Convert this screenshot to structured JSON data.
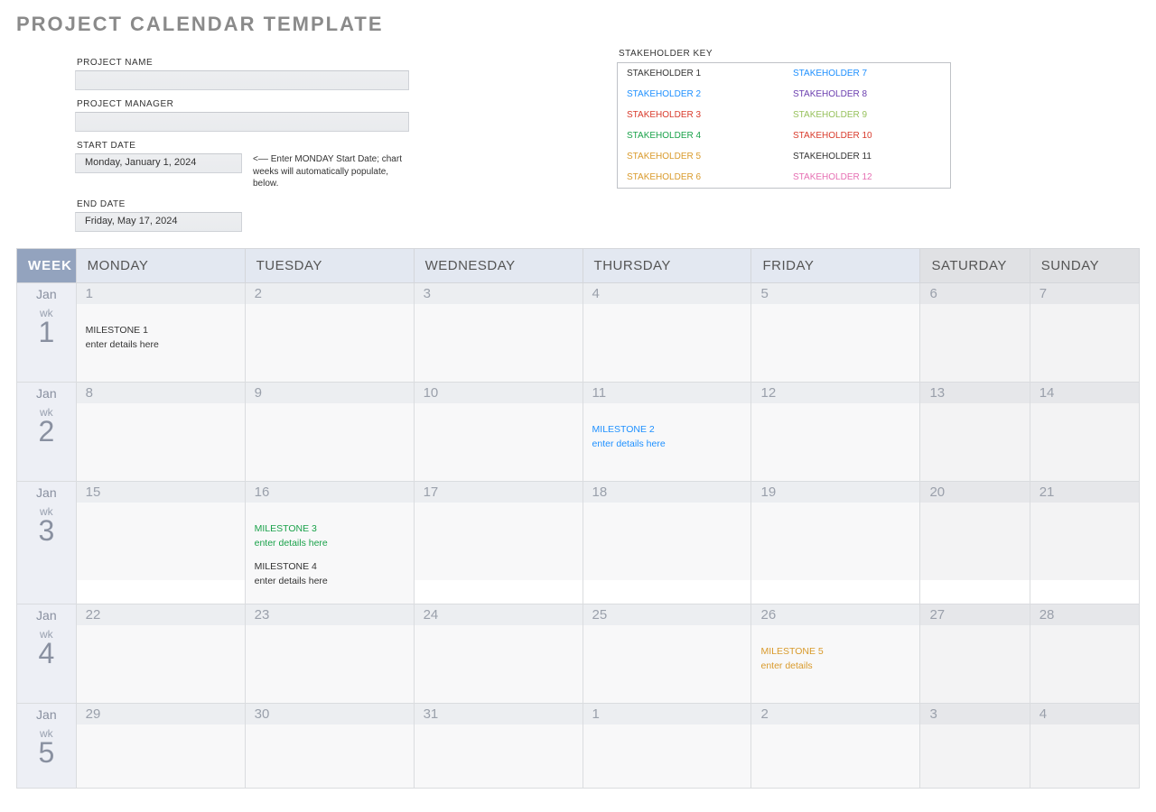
{
  "title": "PROJECT CALENDAR TEMPLATE",
  "form": {
    "project_name_label": "PROJECT NAME",
    "project_name_value": "",
    "project_manager_label": "PROJECT MANAGER",
    "project_manager_value": "",
    "start_date_label": "START DATE",
    "start_date_value": "Monday, January 1, 2024",
    "start_date_hint": "<–– Enter MONDAY Start Date; chart weeks will automatically populate, below.",
    "end_date_label": "END DATE",
    "end_date_value": "Friday, May 17, 2024"
  },
  "stakeholders": {
    "title": "STAKEHOLDER KEY",
    "items": [
      {
        "label": "STAKEHOLDER 1",
        "color": "#333333"
      },
      {
        "label": "STAKEHOLDER 7",
        "color": "#1e90ff"
      },
      {
        "label": "STAKEHOLDER 2",
        "color": "#1e90ff"
      },
      {
        "label": "STAKEHOLDER 8",
        "color": "#6a3dae"
      },
      {
        "label": "STAKEHOLDER 3",
        "color": "#d93a2b"
      },
      {
        "label": "STAKEHOLDER 9",
        "color": "#97c15c"
      },
      {
        "label": "STAKEHOLDER 4",
        "color": "#1aa24a"
      },
      {
        "label": "STAKEHOLDER 10",
        "color": "#d93a2b"
      },
      {
        "label": "STAKEHOLDER 5",
        "color": "#d99a2b"
      },
      {
        "label": "STAKEHOLDER 11",
        "color": "#333333"
      },
      {
        "label": "STAKEHOLDER 6",
        "color": "#d99a2b"
      },
      {
        "label": "STAKEHOLDER 12",
        "color": "#e66fb3"
      }
    ]
  },
  "columns": {
    "week": "WEEK",
    "mon": "MONDAY",
    "tue": "TUESDAY",
    "wed": "WEDNESDAY",
    "thu": "THURSDAY",
    "fri": "FRIDAY",
    "sat": "SATURDAY",
    "sun": "SUNDAY"
  },
  "weeks": [
    {
      "month": "Jan",
      "wk_label": "wk",
      "num": "1",
      "days": [
        {
          "n": "1",
          "ms": [
            {
              "t": "MILESTONE 1",
              "s": "enter details here",
              "c": "#333333"
            }
          ]
        },
        {
          "n": "2"
        },
        {
          "n": "3"
        },
        {
          "n": "4"
        },
        {
          "n": "5"
        },
        {
          "n": "6",
          "we": true
        },
        {
          "n": "7",
          "we": true
        }
      ]
    },
    {
      "month": "Jan",
      "wk_label": "wk",
      "num": "2",
      "days": [
        {
          "n": "8"
        },
        {
          "n": "9"
        },
        {
          "n": "10"
        },
        {
          "n": "11",
          "ms": [
            {
              "t": "MILESTONE 2",
              "s": "enter details here",
              "c": "#1e90ff"
            }
          ]
        },
        {
          "n": "12"
        },
        {
          "n": "13",
          "we": true
        },
        {
          "n": "14",
          "we": true
        }
      ]
    },
    {
      "month": "Jan",
      "wk_label": "wk",
      "num": "3",
      "days": [
        {
          "n": "15"
        },
        {
          "n": "16",
          "ms": [
            {
              "t": "MILESTONE 3",
              "s": "enter details here",
              "c": "#1aa24a"
            },
            {
              "t": "MILESTONE 4",
              "s": "enter details here",
              "c": "#333333"
            }
          ]
        },
        {
          "n": "17"
        },
        {
          "n": "18"
        },
        {
          "n": "19"
        },
        {
          "n": "20",
          "we": true
        },
        {
          "n": "21",
          "we": true
        }
      ]
    },
    {
      "month": "Jan",
      "wk_label": "wk",
      "num": "4",
      "days": [
        {
          "n": "22"
        },
        {
          "n": "23"
        },
        {
          "n": "24"
        },
        {
          "n": "25"
        },
        {
          "n": "26",
          "ms": [
            {
              "t": "MILESTONE 5",
              "s": "enter details",
              "c": "#d99a2b"
            }
          ]
        },
        {
          "n": "27",
          "we": true
        },
        {
          "n": "28",
          "we": true
        }
      ]
    },
    {
      "month": "Jan",
      "wk_label": "wk",
      "num": "5",
      "days": [
        {
          "n": "29"
        },
        {
          "n": "30"
        },
        {
          "n": "31"
        },
        {
          "n": "1"
        },
        {
          "n": "2"
        },
        {
          "n": "3",
          "we": true
        },
        {
          "n": "4",
          "we": true
        }
      ]
    }
  ]
}
